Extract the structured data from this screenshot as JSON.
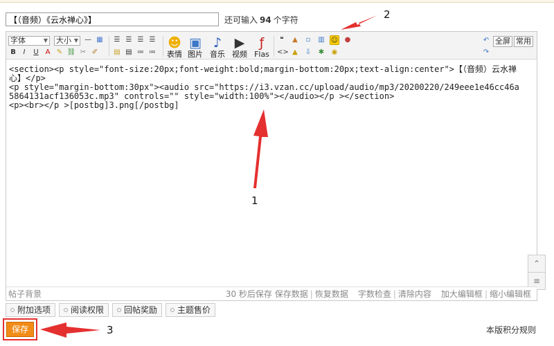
{
  "title": {
    "value": "【（音频）《云水禅心》】",
    "remaining_prefix": "还可输入",
    "remaining_count": "94",
    "remaining_suffix": "个字符"
  },
  "toolbar": {
    "font_select": "字体",
    "size_select": "大小",
    "emoticon_label": "表情",
    "image_label": "图片",
    "music_label": "音乐",
    "video_label": "视频",
    "flash_label": "Flas",
    "fullscreen_label": "全屏",
    "common_label": "常用"
  },
  "editor": {
    "content": "<section><p style=\"font-size:20px;font-weight:bold;margin-bottom:20px;text-align:center\">【（音频）云水禅心】</p>\n<p style=\"margin-bottom:30px\"><audio src=\"https://i3.vzan.cc/upload/audio/mp3/20200220/249eee1e46cc46a5864131acf136053c.mp3\" controls=\"\" style=\"width:100%\"></audio></p ></section>\n<p><br></p >[postbg]3.png[/postbg]"
  },
  "status": {
    "post_bg": "帖子背景",
    "autosave": "30 秒后保存",
    "save_data": "保存数据",
    "restore_data": "恢复数据",
    "word_check": "字数检查",
    "clear_content": "清除内容",
    "enlarge_box": "加大编辑框",
    "shrink_box": "缩小编辑框"
  },
  "options": {
    "attach": "附加选项",
    "read_perm": "阅读权限",
    "reply_reward": "回帖奖励",
    "topic_price": "主题售价"
  },
  "save_label": "保存",
  "rules_link": "本版积分规则",
  "annotations": {
    "a1": "1",
    "a2": "2",
    "a3": "3"
  },
  "colors": {
    "accent_orange": "#f28c18",
    "annotation_red": "#e53030"
  }
}
